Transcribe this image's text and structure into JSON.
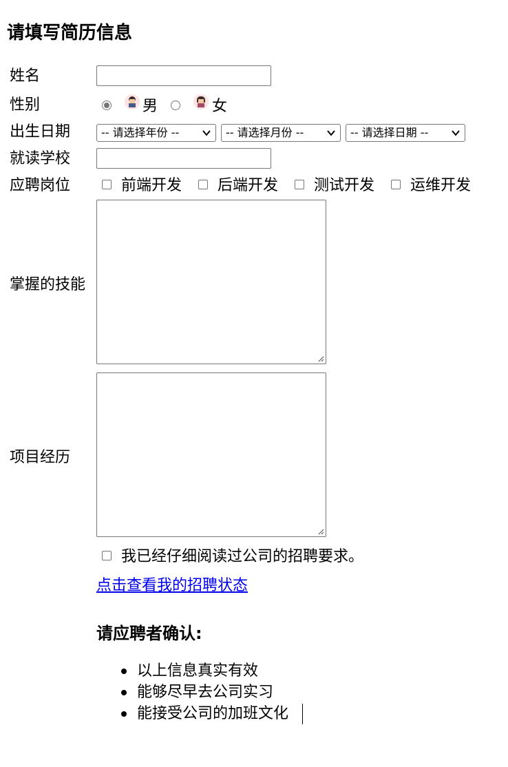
{
  "page": {
    "title": "请填写简历信息"
  },
  "form": {
    "name_label": "姓名",
    "name_value": "",
    "gender_label": "性别",
    "gender_options": [
      "男",
      "女"
    ],
    "gender_selected": "男",
    "birth_label": "出生日期",
    "year_select": "-- 请选择年份 --",
    "month_select": "-- 请选择月份 --",
    "day_select": "-- 请选择日期 --",
    "school_label": "就读学校",
    "school_value": "",
    "position_label": "应聘岗位",
    "positions": [
      "前端开发",
      "后端开发",
      "测试开发",
      "运维开发"
    ],
    "skills_label": "掌握的技能",
    "projects_label": "项目经历",
    "agree_label": "我已经仔细阅读过公司的招聘要求。",
    "status_link": "点击查看我的招聘状态"
  },
  "confirm": {
    "heading": "请应聘者确认:",
    "items": [
      "以上信息真实有效",
      "能够尽早去公司实习",
      "能接受公司的加班文化"
    ]
  },
  "icons": {
    "male_avatar": "male-avatar-icon",
    "female_avatar": "female-avatar-icon",
    "dropdown": "chevron-down-icon",
    "resize": "resize-grip-icon"
  },
  "colors": {
    "link": "#0000ee",
    "control_border": "#767676"
  }
}
